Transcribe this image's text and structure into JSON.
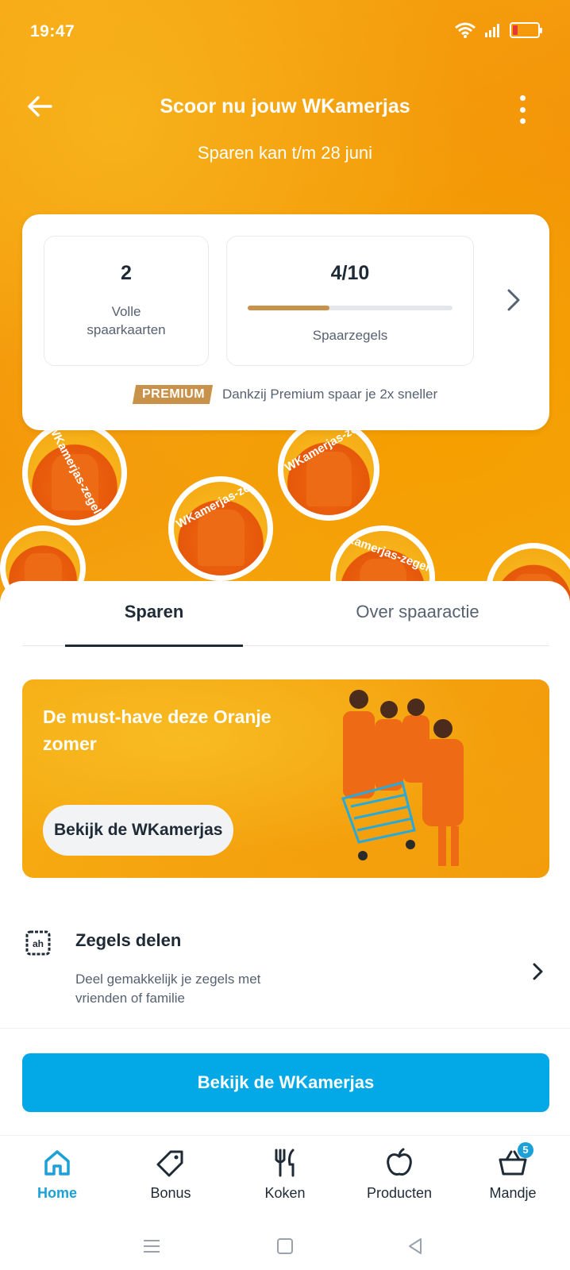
{
  "status_bar": {
    "time": "19:47"
  },
  "header": {
    "title": "Scoor nu jouw WKamerjas",
    "subtitle": "Sparen kan t/m 28 juni"
  },
  "savings_card": {
    "full_cards_count": "2",
    "full_cards_label": "Volle spaarkaarten",
    "stamps_count": "4/10",
    "stamps_progress": 0.4,
    "stamps_label": "Spaarzegels",
    "premium_badge": "PREMIUM",
    "premium_text": "Dankzij Premium spaar je 2x sneller"
  },
  "stamps_decor": {
    "label": "WKamerjas-zegel"
  },
  "tabs": [
    {
      "label": "Sparen",
      "active": true
    },
    {
      "label": "Over spaaractie",
      "active": false
    }
  ],
  "banner": {
    "title": "De must-have deze Oranje zomer",
    "button_label": "Bekijk de WKamerjas"
  },
  "share": {
    "title": "Zegels delen",
    "description": "Deel gemakkelijk je zegels met vrienden of familie"
  },
  "cta": {
    "label": "Bekijk de WKamerjas"
  },
  "bottom_nav": {
    "items": [
      {
        "label": "Home",
        "icon": "home-icon",
        "active": true
      },
      {
        "label": "Bonus",
        "icon": "tag-icon",
        "active": false
      },
      {
        "label": "Koken",
        "icon": "cutlery-icon",
        "active": false
      },
      {
        "label": "Producten",
        "icon": "apple-icon",
        "active": false
      },
      {
        "label": "Mandje",
        "icon": "basket-icon",
        "active": false,
        "badge": "5"
      }
    ]
  },
  "colors": {
    "accent_blue": "#03a9e6",
    "nav_active": "#1ba0d8",
    "premium_gold": "#c9924a",
    "hero_orange": "#f39a0a"
  }
}
